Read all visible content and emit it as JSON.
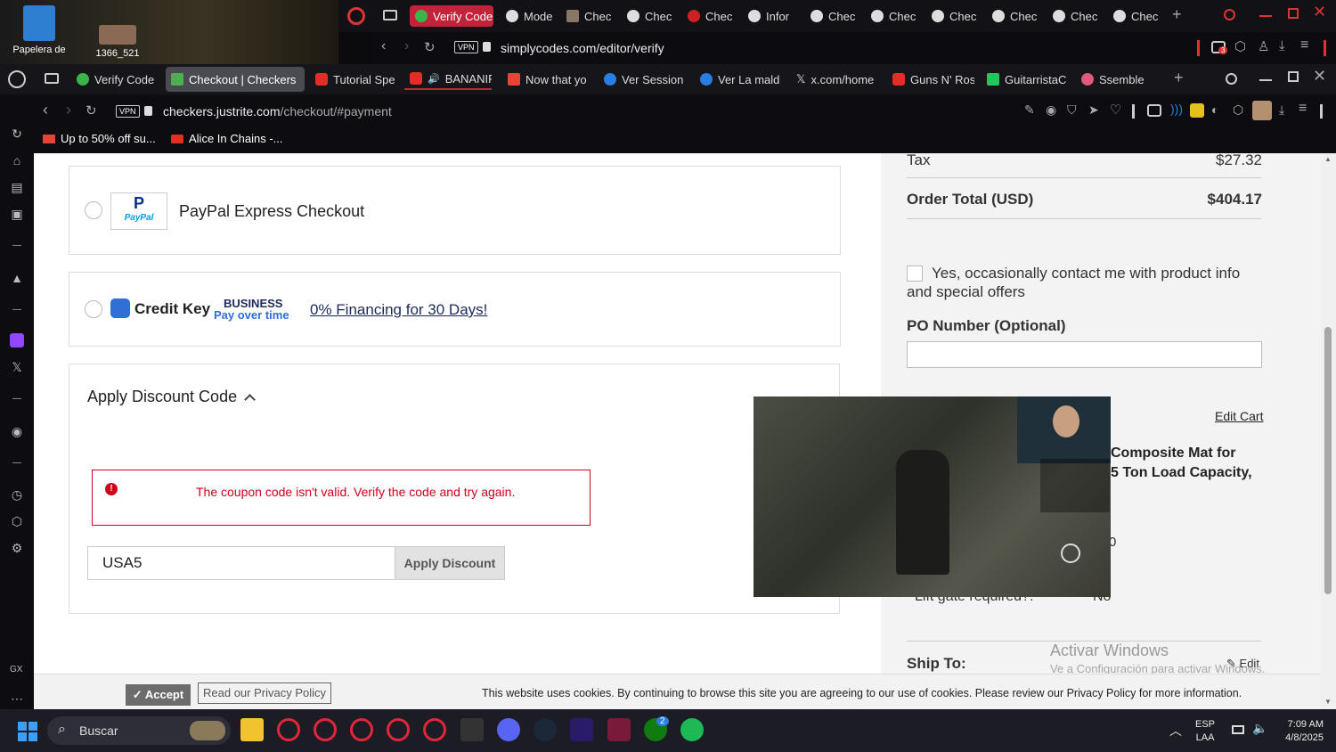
{
  "desktop": {
    "icons": [
      {
        "label": "Papelera de"
      },
      {
        "label": "1366_521"
      }
    ]
  },
  "outer_browser": {
    "tabs": [
      "Verify Code",
      "Mode",
      "Chec",
      "Chec",
      "Chec",
      "Infor",
      "Chec",
      "Chec",
      "Chec",
      "Chec",
      "Chec",
      "Chec"
    ],
    "active_tab": "Verify Code",
    "url": "simplycodes.com/editor/verify",
    "vpn": "VPN",
    "badge_count": "3"
  },
  "inner_browser": {
    "tabs": [
      "Verify Code",
      "Checkout | Checkers",
      "Tutorial Spe",
      "BANANIR",
      "Now that yo",
      "Ver Session",
      "Ver La mald",
      "x.com/home",
      "Guns N' Ros",
      "GuitarristaC",
      "Ssemble"
    ],
    "active_tab": "Checkout | Checkers",
    "url_domain": "checkers.justrite.com",
    "url_path": "/checkout/#payment",
    "vpn": "VPN",
    "bookmarks": [
      "Up to 50% off su...",
      "Alice In Chains -..."
    ]
  },
  "sidebar": {
    "label": "GX"
  },
  "payment": {
    "paypal_label": "PayPal Express Checkout",
    "paypal_logo": "PayPal",
    "creditkey_name": "Credit Key",
    "creditkey_business": "BUSINESS",
    "creditkey_sub": "Pay over time",
    "creditkey_link": "0% Financing for 30 Days!"
  },
  "discount": {
    "title": "Apply Discount Code",
    "error": "The coupon code isn't valid. Verify the code and try again.",
    "input_value": "USA5",
    "button": "Apply Discount"
  },
  "summary": {
    "tax_label": "Tax",
    "tax_value": "$27.32",
    "total_label": "Order Total (USD)",
    "total_value": "$404.17",
    "contact_checkbox": "Yes, occasionally contact me with product info and special offers",
    "contact_checked": false,
    "po_label": "PO Number (Optional)",
    "po_value": "",
    "edit_cart": "Edit Cart",
    "product_line1": "Composite Mat for",
    "product_line2": "5 Ton Load Capacity,",
    "partial_value": "0",
    "liftgate_label": "Lift gate required?:",
    "liftgate_value": "No",
    "ship_to": "Ship To:",
    "edit": "Edit"
  },
  "watermark": {
    "line1": "Activar Windows",
    "line2": "Ve a Configuración para activar Windows."
  },
  "cookie": {
    "accept": "Accept",
    "privacy": "Read our Privacy Policy",
    "message": "This website uses cookies. By continuing to browse this site you are agreeing to our use of cookies. Please review our Privacy Policy for more information."
  },
  "taskbar": {
    "search_placeholder": "Buscar",
    "lang1": "ESP",
    "lang2": "LAA",
    "time": "7:09 AM",
    "date": "4/8/2025",
    "xbox_badge": "2"
  },
  "colors": {
    "error_red": "#d0021b",
    "opera_red": "#c0243a",
    "creditkey_blue": "#2f6fd6"
  }
}
